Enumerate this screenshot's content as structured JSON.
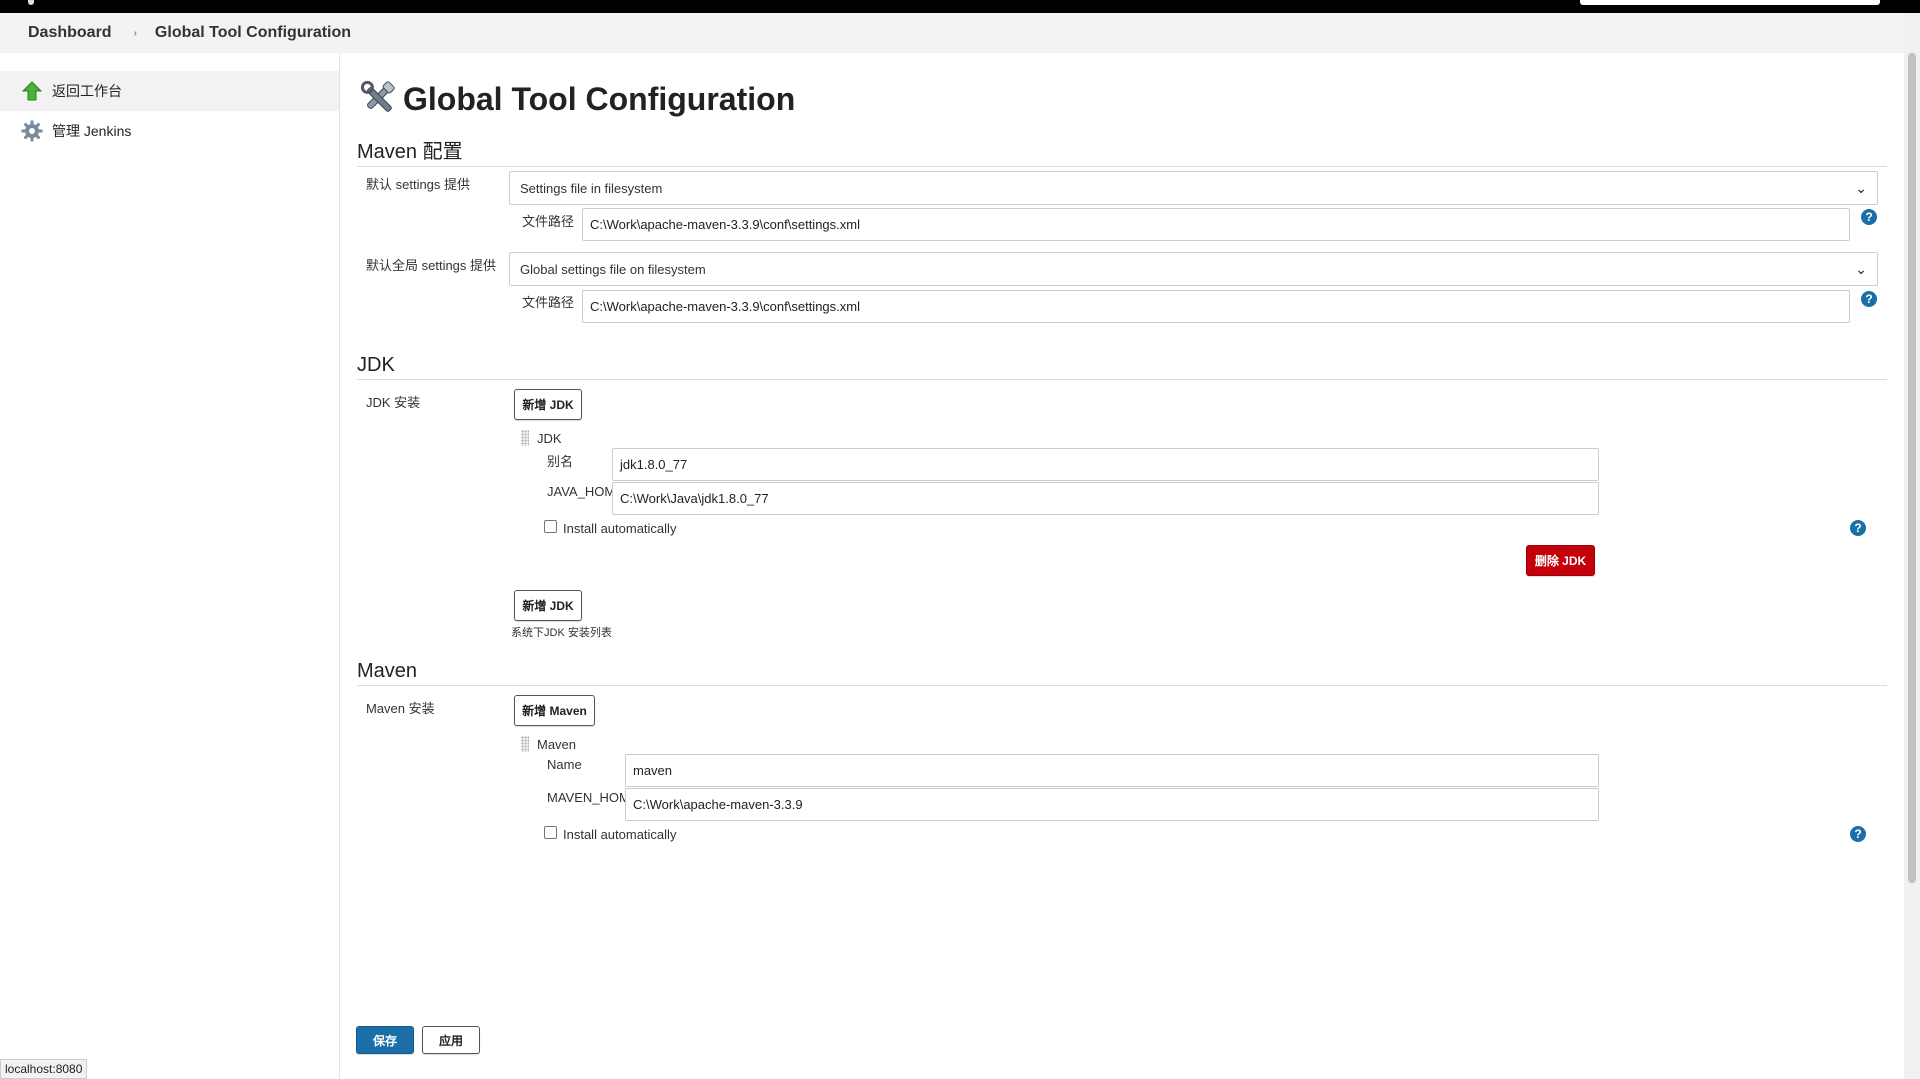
{
  "breadcrumb": {
    "items": [
      "Dashboard",
      "Global Tool Configuration"
    ],
    "separator": "›"
  },
  "sidebar": {
    "items": [
      {
        "label": "返回工作台",
        "icon": "up-arrow-icon"
      },
      {
        "label": "管理 Jenkins",
        "icon": "gear-icon"
      }
    ]
  },
  "page": {
    "title": "Global Tool Configuration"
  },
  "maven_config": {
    "heading": "Maven 配置",
    "default_settings_label": "默认 settings 提供",
    "default_settings_value": "Settings file in filesystem",
    "path_label_1": "文件路径",
    "path_value_1": "C:\\Work\\apache-maven-3.3.9\\conf\\settings.xml",
    "global_settings_label": "默认全局 settings 提供",
    "global_settings_value": "Global settings file on filesystem",
    "path_label_2": "文件路径",
    "path_value_2": "C:\\Work\\apache-maven-3.3.9\\conf\\settings.xml"
  },
  "jdk": {
    "heading": "JDK",
    "install_label": "JDK 安装",
    "add_button": "新增 JDK",
    "item_title": "JDK",
    "alias_label": "别名",
    "alias_value": "jdk1.8.0_77",
    "java_home_label": "JAVA_HOME",
    "java_home_value": "C:\\Work\\Java\\jdk1.8.0_77",
    "install_auto_label": "Install automatically",
    "install_auto_checked": false,
    "delete_button": "删除 JDK",
    "add_button_2": "新增 JDK",
    "list_caption": "系统下JDK 安装列表"
  },
  "maven": {
    "heading": "Maven",
    "install_label": "Maven 安装",
    "add_button": "新增 Maven",
    "item_title": "Maven",
    "name_label": "Name",
    "name_value": "maven",
    "home_label": "MAVEN_HOME",
    "home_value": "C:\\Work\\apache-maven-3.3.9",
    "install_auto_label": "Install automatically"
  },
  "footer": {
    "save_button": "保存",
    "apply_button": "应用"
  },
  "status_bar": {
    "url": "localhost:8080"
  },
  "colors": {
    "primary": "#1b6fa8",
    "danger": "#c4000a",
    "help": "#1b6fa8"
  }
}
